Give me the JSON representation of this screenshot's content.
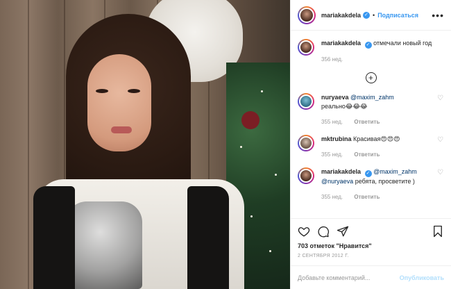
{
  "post": {
    "username": "mariakakdela",
    "follow_label": "Подписаться",
    "dot": "•",
    "more": "•••"
  },
  "caption": {
    "username": "mariakakdela",
    "text": "отмечали новый год",
    "time": "356 нед."
  },
  "load_more": "+",
  "comments": [
    {
      "username": "nuryaeva",
      "mention": "@maxim_zahm",
      "text": "реально😂😂😂",
      "time": "355 нед.",
      "reply": "Ответить"
    },
    {
      "username": "mktrubina",
      "mention": "",
      "text": "Красивая😍😍😍",
      "time": "355 нед.",
      "reply": "Ответить"
    },
    {
      "username": "mariakakdela",
      "mention": "@maxim_zahm",
      "mention2": "@nuryaeva",
      "text": "ребята, просветите )",
      "time": "355 нед.",
      "reply": "Ответить"
    }
  ],
  "likes": "703 отметок \"Нравится\"",
  "date": "2 СЕНТЯБРЯ 2012 Г.",
  "add_comment": {
    "placeholder": "Добавьте комментарий...",
    "publish": "Опубликовать"
  },
  "colors": {
    "accent": "#3897f0",
    "mention": "#003569",
    "muted": "#999999",
    "publish_disabled": "#b2dffc"
  }
}
